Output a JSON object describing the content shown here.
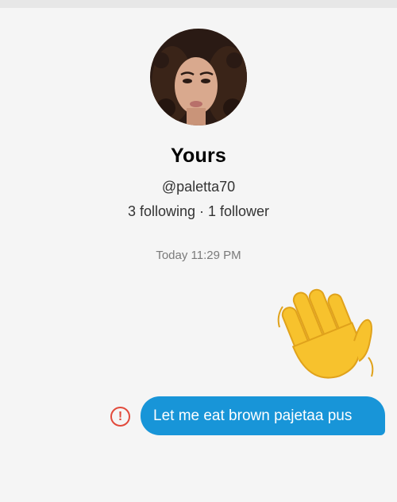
{
  "profile": {
    "name": "Yours",
    "handle": "@paletta70",
    "stats": "3 following · 1 follower"
  },
  "conversation": {
    "timestamp": "Today 11:29 PM",
    "messages": [
      {
        "type": "emoji",
        "content": "👋",
        "icon": "waving-hand"
      },
      {
        "type": "text",
        "content": "Let me eat brown pajetaa pus",
        "status": "failed",
        "status_icon": "error-icon"
      }
    ]
  },
  "colors": {
    "background": "#f5f5f5",
    "bubble": "#1895d8",
    "error": "#e24a3b"
  }
}
